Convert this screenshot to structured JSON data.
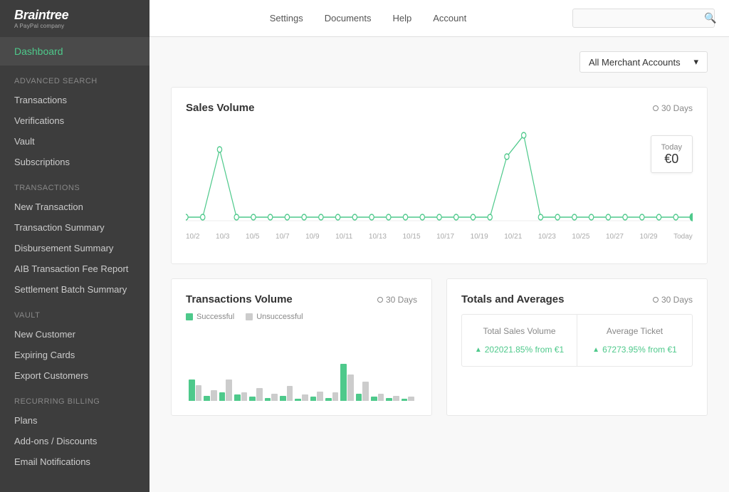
{
  "logo": {
    "main": "Braintree",
    "sub": "A PayPal company"
  },
  "topnav": {
    "links": [
      "Settings",
      "Documents",
      "Help",
      "Account"
    ],
    "search_placeholder": ""
  },
  "sidebar": {
    "dashboard_label": "Dashboard",
    "sections": [
      {
        "label": "Advanced Search",
        "items": [
          "Transactions",
          "Verifications",
          "Vault",
          "Subscriptions"
        ]
      },
      {
        "label": "Transactions",
        "items": [
          "New Transaction",
          "Transaction Summary",
          "Disbursement Summary",
          "AIB Transaction Fee Report",
          "Settlement Batch Summary"
        ]
      },
      {
        "label": "Vault",
        "items": [
          "New Customer",
          "Expiring Cards",
          "Export Customers"
        ]
      },
      {
        "label": "Recurring Billing",
        "items": [
          "Plans",
          "Add-ons / Discounts",
          "Email Notifications"
        ]
      }
    ]
  },
  "merchant_dropdown": {
    "label": "All Merchant Accounts",
    "chevron": "▾"
  },
  "sales_volume": {
    "title": "Sales Volume",
    "period_label": "30 Days",
    "today_label": "Today",
    "today_value": "€0",
    "x_labels": [
      "10/2",
      "10/3",
      "10/5",
      "10/7",
      "10/9",
      "10/11",
      "10/13",
      "10/15",
      "10/17",
      "10/19",
      "10/21",
      "10/23",
      "10/25",
      "10/27",
      "10/29",
      "Today"
    ]
  },
  "transactions_volume": {
    "title": "Transactions Volume",
    "period_label": "30 Days",
    "legend_successful": "Successful",
    "legend_unsuccessful": "Unsuccessful",
    "bars": [
      {
        "success": 20,
        "fail": 15
      },
      {
        "success": 5,
        "fail": 10
      },
      {
        "success": 8,
        "fail": 20
      },
      {
        "success": 6,
        "fail": 8
      },
      {
        "success": 4,
        "fail": 12
      },
      {
        "success": 3,
        "fail": 7
      },
      {
        "success": 5,
        "fail": 14
      },
      {
        "success": 2,
        "fail": 6
      },
      {
        "success": 4,
        "fail": 9
      },
      {
        "success": 3,
        "fail": 8
      },
      {
        "success": 35,
        "fail": 25
      },
      {
        "success": 7,
        "fail": 18
      },
      {
        "success": 4,
        "fail": 7
      },
      {
        "success": 3,
        "fail": 5
      },
      {
        "success": 2,
        "fail": 4
      }
    ]
  },
  "totals_averages": {
    "title": "Totals and Averages",
    "period_label": "30 Days",
    "cells": [
      {
        "label": "Total Sales Volume",
        "value": "202021.85% from €1"
      },
      {
        "label": "Average Ticket",
        "value": "67273.95% from €1"
      }
    ]
  },
  "icons": {
    "search": "🔍",
    "circle": "○",
    "chevron_down": "▾",
    "arrow_up": "▲"
  }
}
